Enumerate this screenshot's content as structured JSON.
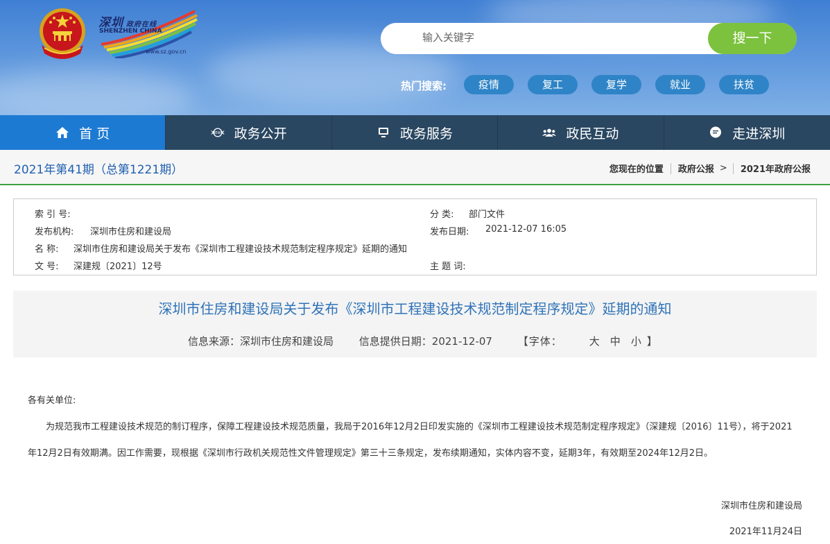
{
  "header": {
    "logo_text_cn": "深圳",
    "logo_text_sub": "政府在线",
    "logo_text_en": "SHENZHEN CHINA",
    "logo_url": "www.sz.gov.cn",
    "search_placeholder": "输入关键字",
    "search_button": "搜一下",
    "hot_label": "热门搜索:",
    "hot_tags": [
      "疫情",
      "复工",
      "复学",
      "就业",
      "扶贫"
    ]
  },
  "nav": {
    "items": [
      {
        "label": "首 页",
        "icon": "home-icon"
      },
      {
        "label": "政务公开",
        "icon": "news-icon"
      },
      {
        "label": "政务服务",
        "icon": "monitor-icon"
      },
      {
        "label": "政民互动",
        "icon": "people-icon"
      },
      {
        "label": "走进深圳",
        "icon": "chat-icon"
      }
    ]
  },
  "crumbbar": {
    "issue": "2021年第41期（总第1221期）",
    "location_label": "您现在的位置",
    "crumb1": "政府公报",
    "gt": ">",
    "crumb2": "2021年政府公报"
  },
  "info": {
    "index_label": "索 引 号:",
    "index_value": "",
    "category_label": "分    类:",
    "category_value": "部门文件",
    "publisher_label": "发布机构:",
    "publisher_value": "深圳市住房和建设局",
    "date_label": "发布日期:",
    "date_value": "2021-12-07 16:05",
    "name_label": "名    称:",
    "name_value": "深圳市住房和建设局关于发布《深圳市工程建设技术规范制定程序规定》延期的通知",
    "keyword_label": "主 题 词:",
    "keyword_value": "",
    "docno_label": "文    号:",
    "docno_value": "深建规〔2021〕12号"
  },
  "article": {
    "title": "深圳市住房和建设局关于发布《深圳市工程建设技术规范制定程序规定》延期的通知",
    "source": "信息来源：深圳市住房和建设局",
    "provided_date": "信息提供日期：2021-12-07",
    "font_label_open": "【字体：",
    "font_big": "大",
    "font_mid": "中",
    "font_small": "小",
    "font_label_close": "】",
    "salutation": "各有关单位:",
    "paragraph": "为规范我市工程建设技术规范的制订程序，保障工程建设技术规范质量，我局于2016年12月2日印发实施的《深圳市工程建设技术规范制定程序规定》（深建规〔2016〕11号），将于2021年12月2日有效期满。因工作需要，现根据《深圳市行政机关规范性文件管理规定》第三十三条规定，发布续期通知，实体内容不变，延期3年，有效期至2024年12月2日。",
    "signature": "深圳市住房和建设局",
    "sign_date": "2021年11月24日"
  },
  "colors": {
    "nav_bg": "#2a4761",
    "nav_active": "#1d7ad3",
    "search_btn": "#7cc23e",
    "hot_tag": "#2f84c7",
    "title_blue": "#2f73b8",
    "green_line": "#3aa043"
  }
}
